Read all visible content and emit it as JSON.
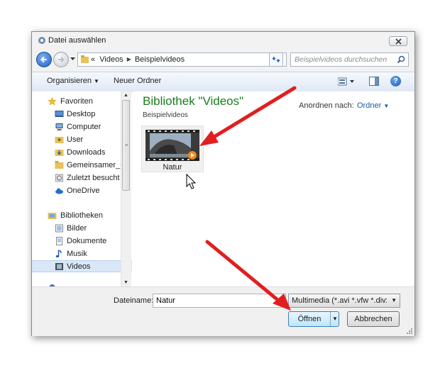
{
  "window": {
    "title": "Datei auswählen"
  },
  "address": {
    "prefix": "«",
    "crumbs": [
      "Videos",
      "Beispielvideos"
    ]
  },
  "search": {
    "placeholder": "Beispielvideos durchsuchen"
  },
  "toolbar": {
    "organise_label": "Organisieren",
    "new_folder_label": "Neuer Ordner"
  },
  "sidebar": {
    "items": [
      {
        "label": "Favoriten",
        "icon": "star-icon"
      },
      {
        "label": "Desktop",
        "icon": "desktop-icon"
      },
      {
        "label": "Computer",
        "icon": "computer-icon"
      },
      {
        "label": "User",
        "icon": "user-folder-icon"
      },
      {
        "label": "Downloads",
        "icon": "downloads-icon"
      },
      {
        "label": "Gemeinsamer_Or",
        "icon": "folder-icon"
      },
      {
        "label": "Zuletzt besucht",
        "icon": "recent-icon"
      },
      {
        "label": "OneDrive",
        "icon": "cloud-icon"
      },
      {
        "label": "Bibliotheken",
        "icon": "libraries-icon"
      },
      {
        "label": "Bilder",
        "icon": "pictures-icon"
      },
      {
        "label": "Dokumente",
        "icon": "documents-icon"
      },
      {
        "label": "Musik",
        "icon": "music-icon"
      },
      {
        "label": "Videos",
        "icon": "videos-icon",
        "selected": true
      }
    ]
  },
  "content": {
    "library_title": "Bibliothek \"Videos\"",
    "library_subtitle": "Beispielvideos",
    "arrange_label": "Anordnen nach:",
    "arrange_value": "Ordner",
    "files": [
      {
        "name": "Natur",
        "icon": "video-thumbnail-icon"
      }
    ]
  },
  "bottom": {
    "filename_label": "Dateiname:",
    "filename_value": "Natur",
    "filter_value": "Multimedia (*.avi *.vfw *.divx *.",
    "open_label": "Öffnen",
    "cancel_label": "Abbrechen"
  },
  "colors": {
    "accent_arrow": "#e21e1e",
    "library_title": "#1e7b1e",
    "link": "#1a5aa8"
  }
}
